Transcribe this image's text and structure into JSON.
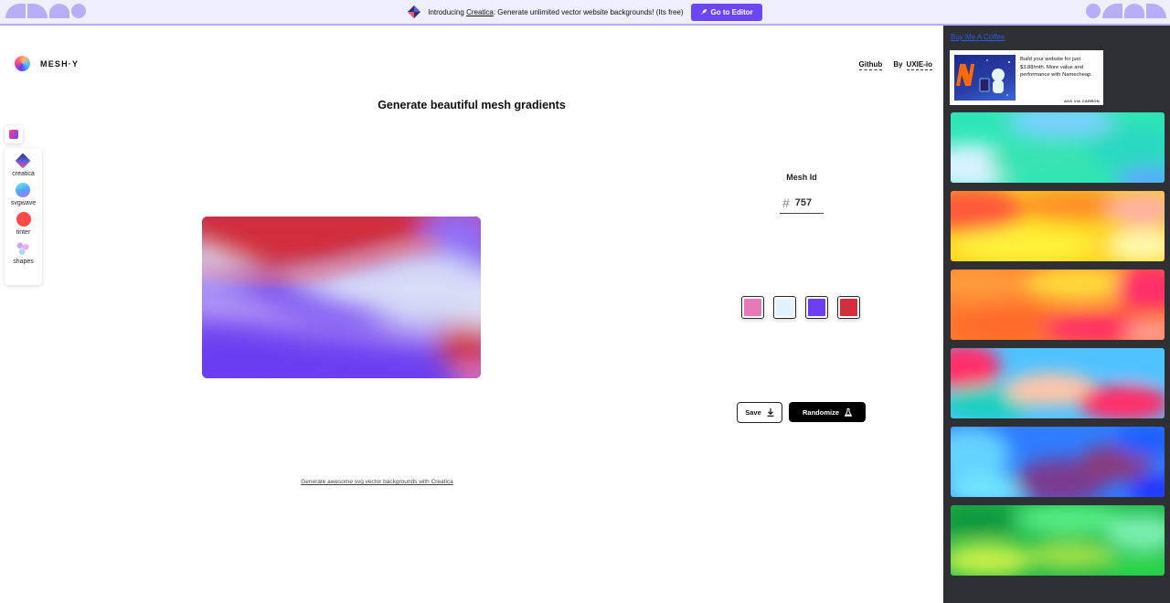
{
  "banner": {
    "intro_prefix": "Introducing ",
    "intro_link": "Creatica",
    "intro_suffix": ": Generate unlimited vector website backgrounds! (Its free)",
    "editor_button": "Go to Editor",
    "editor_button_icon": "rocket-icon",
    "accent": "#6b46f5"
  },
  "header": {
    "brand": "MESH·Y",
    "github": "Github",
    "by": "By",
    "author": "UXIE-io"
  },
  "headline": "Generate beautiful mesh gradients",
  "tools": [
    {
      "label": "creatica",
      "icon": "creatica-icon"
    },
    {
      "label": "svgwave",
      "icon": "svgwave-icon"
    },
    {
      "label": "tinter",
      "icon": "tinter-icon"
    },
    {
      "label": "shapes",
      "icon": "shapes-icon"
    }
  ],
  "mesh": {
    "id_label": "Mesh Id",
    "hash": "#",
    "id_value": "757",
    "colors": [
      "#e879b9",
      "#e3f2ff",
      "#6b3ef0",
      "#d12f3c"
    ]
  },
  "actions": {
    "save": "Save",
    "save_icon": "download-icon",
    "randomize": "Randomize",
    "randomize_icon": "flask-icon"
  },
  "footer_link": "Generate awesome svg vector backgrounds with Creatica",
  "sidebar": {
    "coffee_link": "Buy Me A Coffee",
    "ad_text": "Build your website for just $3.88/mth. More value and performance with Namecheap.",
    "ad_via": "ADS VIA CARBON",
    "gallery_thumbnails": 6
  }
}
